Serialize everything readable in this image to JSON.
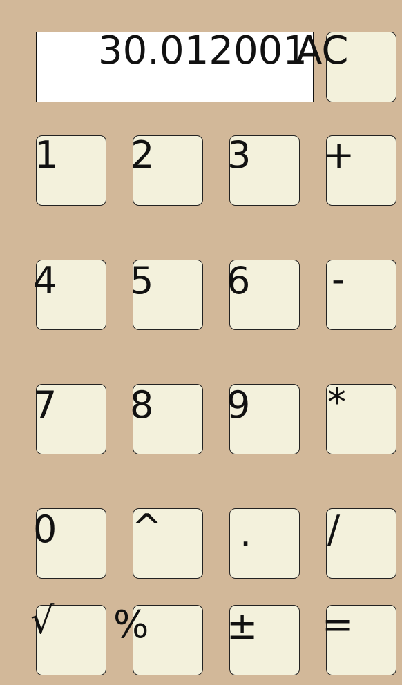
{
  "display": {
    "value": "30.012001"
  },
  "keys": {
    "clear": "AC",
    "one": "1",
    "two": "2",
    "three": "3",
    "plus": "+",
    "four": "4",
    "five": "5",
    "six": "6",
    "minus": "-",
    "seven": "7",
    "eight": "8",
    "nine": "9",
    "multiply": "*",
    "zero": "0",
    "power": "^",
    "decimal": ".",
    "divide": "/",
    "sqrt": "√",
    "percent": "%",
    "plusminus": "±",
    "equals": "="
  },
  "colors": {
    "background": "#d2b899",
    "key_face": "#f3f1dc",
    "display_face": "#ffffff",
    "text": "#111111"
  }
}
